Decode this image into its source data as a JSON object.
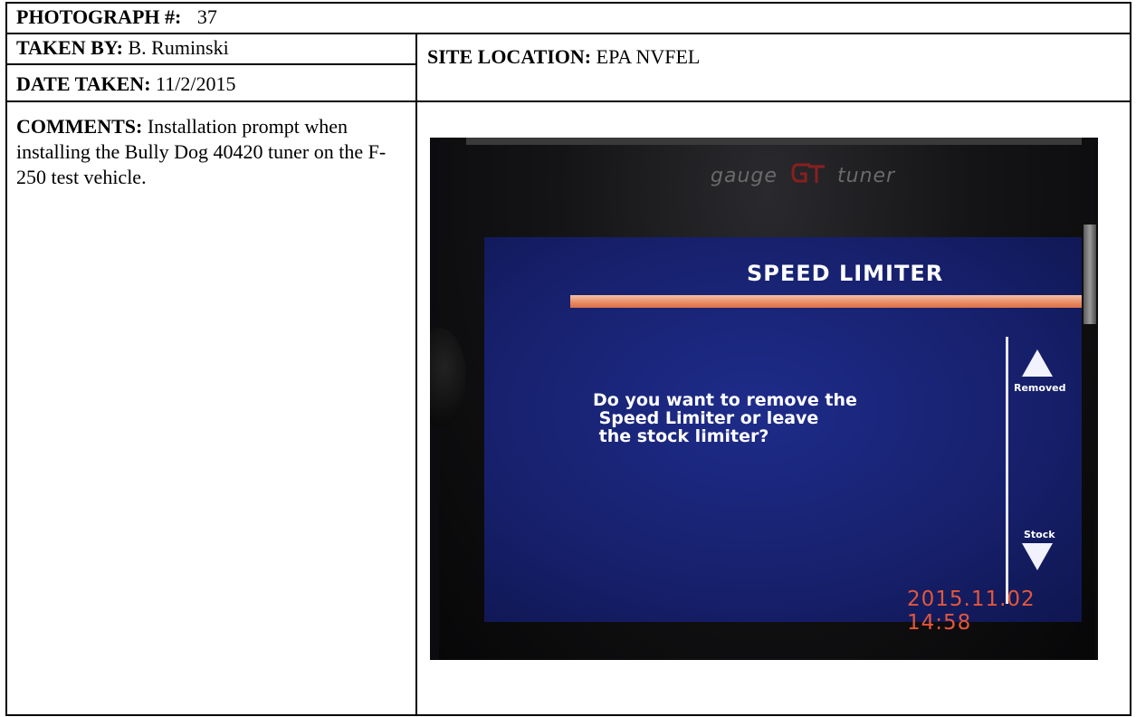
{
  "form": {
    "photograph_label": "PHOTOGRAPH #:",
    "photograph_number": "37",
    "taken_by_label": "TAKEN BY:",
    "taken_by_value": "B. Ruminski",
    "site_location_label": "SITE LOCATION:",
    "site_location_value": "EPA NVFEL",
    "date_taken_label": "DATE TAKEN:",
    "date_taken_value": "11/2/2015",
    "comments_label": "COMMENTS:",
    "comments_value": "Installation prompt when installing the Bully Dog 40420 tuner on the F-250 test vehicle."
  },
  "photo": {
    "brand_left": "gauge",
    "brand_right": "tuner",
    "screen_title": "SPEED LIMITER",
    "question": "Do you want to remove the\n Speed Limiter or leave\n the stock limiter?",
    "up_button_label": "Removed",
    "down_button_label": "Stock",
    "timestamp": "2015.11.02 14:58",
    "colors": {
      "screen_blue": "#17216e",
      "title_bar_orange": "#e88a60",
      "timestamp_orange": "#e4573a"
    }
  }
}
